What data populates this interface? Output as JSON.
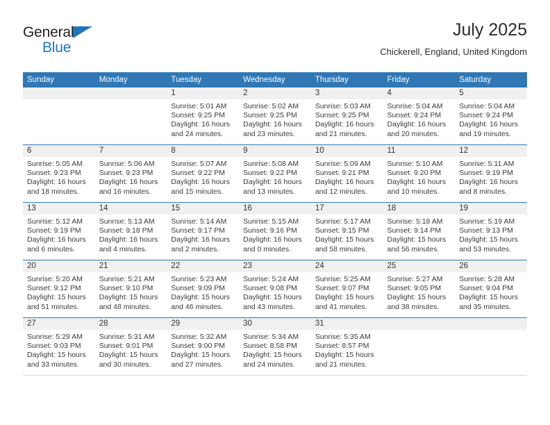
{
  "brand": {
    "name_part1": "General",
    "name_part2": "Blue",
    "accent_color": "#1e76bd",
    "triangle_icon": "triangle-icon"
  },
  "header": {
    "title": "July 2025",
    "location": "Chickerell, England, United Kingdom",
    "header_bg_color": "#3077b5",
    "header_text_color": "#ffffff"
  },
  "weekday_headers": [
    "Sunday",
    "Monday",
    "Tuesday",
    "Wednesday",
    "Thursday",
    "Friday",
    "Saturday"
  ],
  "labels": {
    "sunrise_prefix": "Sunrise:",
    "sunset_prefix": "Sunset:",
    "daylight_prefix": "Daylight:"
  },
  "weeks": [
    [
      {
        "day": "",
        "blank": true
      },
      {
        "day": "",
        "blank": true
      },
      {
        "day": "1",
        "sunrise": "Sunrise: 5:01 AM",
        "sunset": "Sunset: 9:25 PM",
        "daylight_1": "Daylight: 16 hours",
        "daylight_2": "and 24 minutes."
      },
      {
        "day": "2",
        "sunrise": "Sunrise: 5:02 AM",
        "sunset": "Sunset: 9:25 PM",
        "daylight_1": "Daylight: 16 hours",
        "daylight_2": "and 23 minutes."
      },
      {
        "day": "3",
        "sunrise": "Sunrise: 5:03 AM",
        "sunset": "Sunset: 9:25 PM",
        "daylight_1": "Daylight: 16 hours",
        "daylight_2": "and 21 minutes."
      },
      {
        "day": "4",
        "sunrise": "Sunrise: 5:04 AM",
        "sunset": "Sunset: 9:24 PM",
        "daylight_1": "Daylight: 16 hours",
        "daylight_2": "and 20 minutes."
      },
      {
        "day": "5",
        "sunrise": "Sunrise: 5:04 AM",
        "sunset": "Sunset: 9:24 PM",
        "daylight_1": "Daylight: 16 hours",
        "daylight_2": "and 19 minutes."
      }
    ],
    [
      {
        "day": "6",
        "sunrise": "Sunrise: 5:05 AM",
        "sunset": "Sunset: 9:23 PM",
        "daylight_1": "Daylight: 16 hours",
        "daylight_2": "and 18 minutes."
      },
      {
        "day": "7",
        "sunrise": "Sunrise: 5:06 AM",
        "sunset": "Sunset: 9:23 PM",
        "daylight_1": "Daylight: 16 hours",
        "daylight_2": "and 16 minutes."
      },
      {
        "day": "8",
        "sunrise": "Sunrise: 5:07 AM",
        "sunset": "Sunset: 9:22 PM",
        "daylight_1": "Daylight: 16 hours",
        "daylight_2": "and 15 minutes."
      },
      {
        "day": "9",
        "sunrise": "Sunrise: 5:08 AM",
        "sunset": "Sunset: 9:22 PM",
        "daylight_1": "Daylight: 16 hours",
        "daylight_2": "and 13 minutes."
      },
      {
        "day": "10",
        "sunrise": "Sunrise: 5:09 AM",
        "sunset": "Sunset: 9:21 PM",
        "daylight_1": "Daylight: 16 hours",
        "daylight_2": "and 12 minutes."
      },
      {
        "day": "11",
        "sunrise": "Sunrise: 5:10 AM",
        "sunset": "Sunset: 9:20 PM",
        "daylight_1": "Daylight: 16 hours",
        "daylight_2": "and 10 minutes."
      },
      {
        "day": "12",
        "sunrise": "Sunrise: 5:11 AM",
        "sunset": "Sunset: 9:19 PM",
        "daylight_1": "Daylight: 16 hours",
        "daylight_2": "and 8 minutes."
      }
    ],
    [
      {
        "day": "13",
        "sunrise": "Sunrise: 5:12 AM",
        "sunset": "Sunset: 9:19 PM",
        "daylight_1": "Daylight: 16 hours",
        "daylight_2": "and 6 minutes."
      },
      {
        "day": "14",
        "sunrise": "Sunrise: 5:13 AM",
        "sunset": "Sunset: 9:18 PM",
        "daylight_1": "Daylight: 16 hours",
        "daylight_2": "and 4 minutes."
      },
      {
        "day": "15",
        "sunrise": "Sunrise: 5:14 AM",
        "sunset": "Sunset: 9:17 PM",
        "daylight_1": "Daylight: 16 hours",
        "daylight_2": "and 2 minutes."
      },
      {
        "day": "16",
        "sunrise": "Sunrise: 5:15 AM",
        "sunset": "Sunset: 9:16 PM",
        "daylight_1": "Daylight: 16 hours",
        "daylight_2": "and 0 minutes."
      },
      {
        "day": "17",
        "sunrise": "Sunrise: 5:17 AM",
        "sunset": "Sunset: 9:15 PM",
        "daylight_1": "Daylight: 15 hours",
        "daylight_2": "and 58 minutes."
      },
      {
        "day": "18",
        "sunrise": "Sunrise: 5:18 AM",
        "sunset": "Sunset: 9:14 PM",
        "daylight_1": "Daylight: 15 hours",
        "daylight_2": "and 56 minutes."
      },
      {
        "day": "19",
        "sunrise": "Sunrise: 5:19 AM",
        "sunset": "Sunset: 9:13 PM",
        "daylight_1": "Daylight: 15 hours",
        "daylight_2": "and 53 minutes."
      }
    ],
    [
      {
        "day": "20",
        "sunrise": "Sunrise: 5:20 AM",
        "sunset": "Sunset: 9:12 PM",
        "daylight_1": "Daylight: 15 hours",
        "daylight_2": "and 51 minutes."
      },
      {
        "day": "21",
        "sunrise": "Sunrise: 5:21 AM",
        "sunset": "Sunset: 9:10 PM",
        "daylight_1": "Daylight: 15 hours",
        "daylight_2": "and 48 minutes."
      },
      {
        "day": "22",
        "sunrise": "Sunrise: 5:23 AM",
        "sunset": "Sunset: 9:09 PM",
        "daylight_1": "Daylight: 15 hours",
        "daylight_2": "and 46 minutes."
      },
      {
        "day": "23",
        "sunrise": "Sunrise: 5:24 AM",
        "sunset": "Sunset: 9:08 PM",
        "daylight_1": "Daylight: 15 hours",
        "daylight_2": "and 43 minutes."
      },
      {
        "day": "24",
        "sunrise": "Sunrise: 5:25 AM",
        "sunset": "Sunset: 9:07 PM",
        "daylight_1": "Daylight: 15 hours",
        "daylight_2": "and 41 minutes."
      },
      {
        "day": "25",
        "sunrise": "Sunrise: 5:27 AM",
        "sunset": "Sunset: 9:05 PM",
        "daylight_1": "Daylight: 15 hours",
        "daylight_2": "and 38 minutes."
      },
      {
        "day": "26",
        "sunrise": "Sunrise: 5:28 AM",
        "sunset": "Sunset: 9:04 PM",
        "daylight_1": "Daylight: 15 hours",
        "daylight_2": "and 35 minutes."
      }
    ],
    [
      {
        "day": "27",
        "sunrise": "Sunrise: 5:29 AM",
        "sunset": "Sunset: 9:03 PM",
        "daylight_1": "Daylight: 15 hours",
        "daylight_2": "and 33 minutes."
      },
      {
        "day": "28",
        "sunrise": "Sunrise: 5:31 AM",
        "sunset": "Sunset: 9:01 PM",
        "daylight_1": "Daylight: 15 hours",
        "daylight_2": "and 30 minutes."
      },
      {
        "day": "29",
        "sunrise": "Sunrise: 5:32 AM",
        "sunset": "Sunset: 9:00 PM",
        "daylight_1": "Daylight: 15 hours",
        "daylight_2": "and 27 minutes."
      },
      {
        "day": "30",
        "sunrise": "Sunrise: 5:34 AM",
        "sunset": "Sunset: 8:58 PM",
        "daylight_1": "Daylight: 15 hours",
        "daylight_2": "and 24 minutes."
      },
      {
        "day": "31",
        "sunrise": "Sunrise: 5:35 AM",
        "sunset": "Sunset: 8:57 PM",
        "daylight_1": "Daylight: 15 hours",
        "daylight_2": "and 21 minutes."
      },
      {
        "day": "",
        "blank": true
      },
      {
        "day": "",
        "blank": true
      }
    ]
  ]
}
